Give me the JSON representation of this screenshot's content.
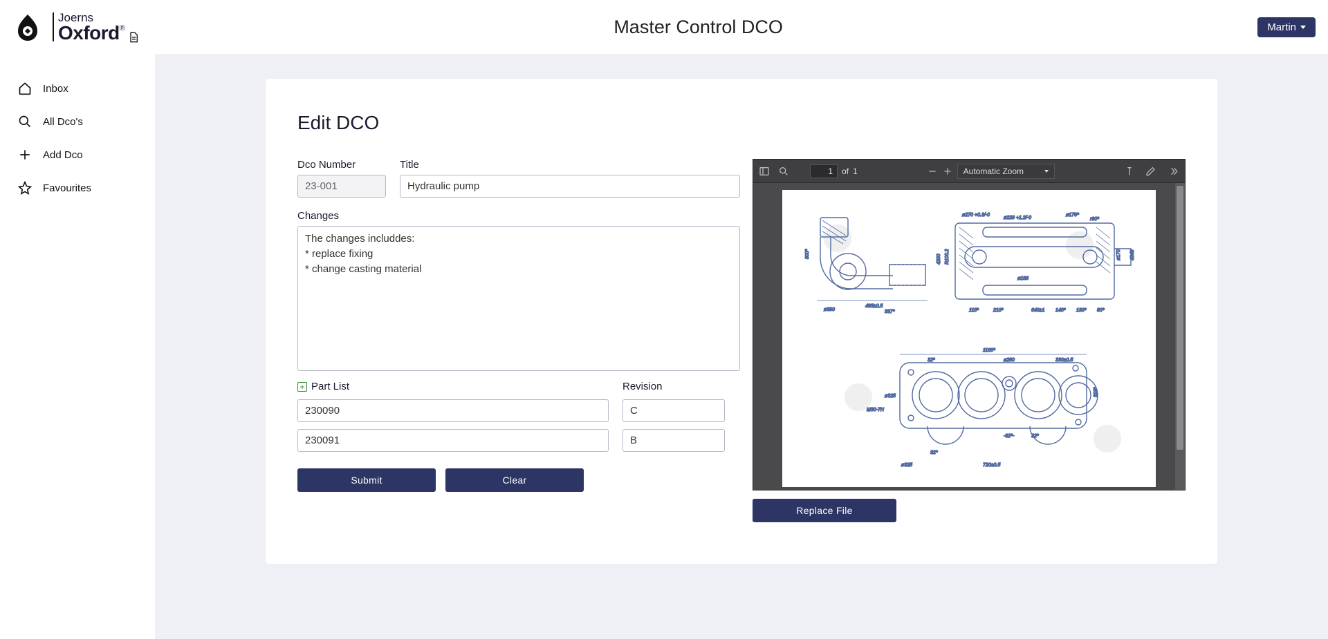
{
  "header": {
    "brand_top": "Joerns",
    "brand_bottom": "Oxford",
    "brand_reg": "®",
    "title": "Master Control DCO",
    "user": "Martin"
  },
  "sidebar": {
    "items": [
      {
        "label": "Inbox"
      },
      {
        "label": "All Dco's"
      },
      {
        "label": "Add Dco"
      },
      {
        "label": "Favourites"
      }
    ]
  },
  "form": {
    "heading": "Edit DCO",
    "labels": {
      "dco_number": "Dco Number",
      "title": "Title",
      "changes": "Changes",
      "part_list": "Part List",
      "revision": "Revision"
    },
    "values": {
      "dco_number": "23-001",
      "title": "Hydraulic pump",
      "changes": "The changes includdes:\n* replace fixing\n* change casting material"
    },
    "parts": [
      {
        "number": "230090",
        "rev": "C"
      },
      {
        "number": "230091",
        "rev": "B"
      }
    ],
    "buttons": {
      "submit": "Submit",
      "clear": "Clear",
      "replace_file": "Replace File"
    }
  },
  "pdf": {
    "page": "1",
    "page_of_prefix": "of",
    "page_total": "1",
    "zoom_label": "Automatic Zoom"
  }
}
